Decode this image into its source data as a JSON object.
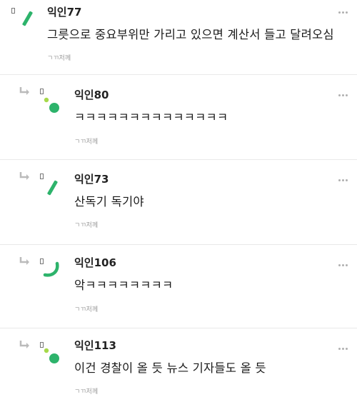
{
  "comments": [
    {
      "nickname": "익인77",
      "text": "그릇으로 중요부위만 가리고 있으면 계산서 들고 달려오심",
      "footer": "ㄱㄲ저께",
      "avatar": "green-bar-icon"
    },
    {
      "nickname": "익인80",
      "text": "ㅋㅋㅋㅋㅋㅋㅋㅋㅋㅋㅋㅋㅋㅋ",
      "footer": "ㄱㄲ저께",
      "avatar": "green-dots-icon"
    },
    {
      "nickname": "익인73",
      "text": "산독기 독기야",
      "footer": "ㄱㄲ저께",
      "avatar": "green-bar-icon"
    },
    {
      "nickname": "익인106",
      "text": "악ㅋㅋㅋㅋㅋㅋㅋㅋ",
      "footer": "ㄱㄲ저께",
      "avatar": "green-arc-icon"
    },
    {
      "nickname": "익인113",
      "text": "이건 경찰이 올 듯 뉴스 기자들도 올 듯",
      "footer": "ㄱㄲ저께",
      "avatar": "green-dots-icon"
    }
  ],
  "icons": {
    "reply": "reply-arrow-icon",
    "more": "more-options-icon"
  },
  "colors": {
    "accent_green": "#2db36b",
    "light_green": "#a6d94a",
    "divider": "#e9e9e9",
    "footer_text": "#9a9a9a"
  }
}
